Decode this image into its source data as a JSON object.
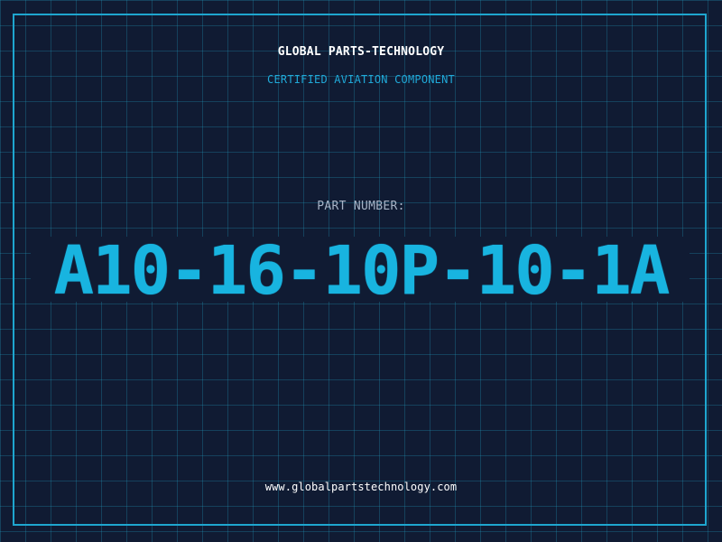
{
  "company": {
    "name": "GLOBAL PARTS-TECHNOLOGY",
    "tagline": "CERTIFIED AVIATION COMPONENT"
  },
  "part": {
    "label": "PART NUMBER:",
    "number": "A10-16-10P-10-1A"
  },
  "footer": {
    "website": "www.globalpartstechnology.com"
  },
  "colors": {
    "background": "#101b33",
    "accent": "#18b4e0",
    "frame": "#1ea6cf",
    "grid": "#2299bb",
    "label": "#a7b4c7",
    "white": "#ffffff"
  }
}
